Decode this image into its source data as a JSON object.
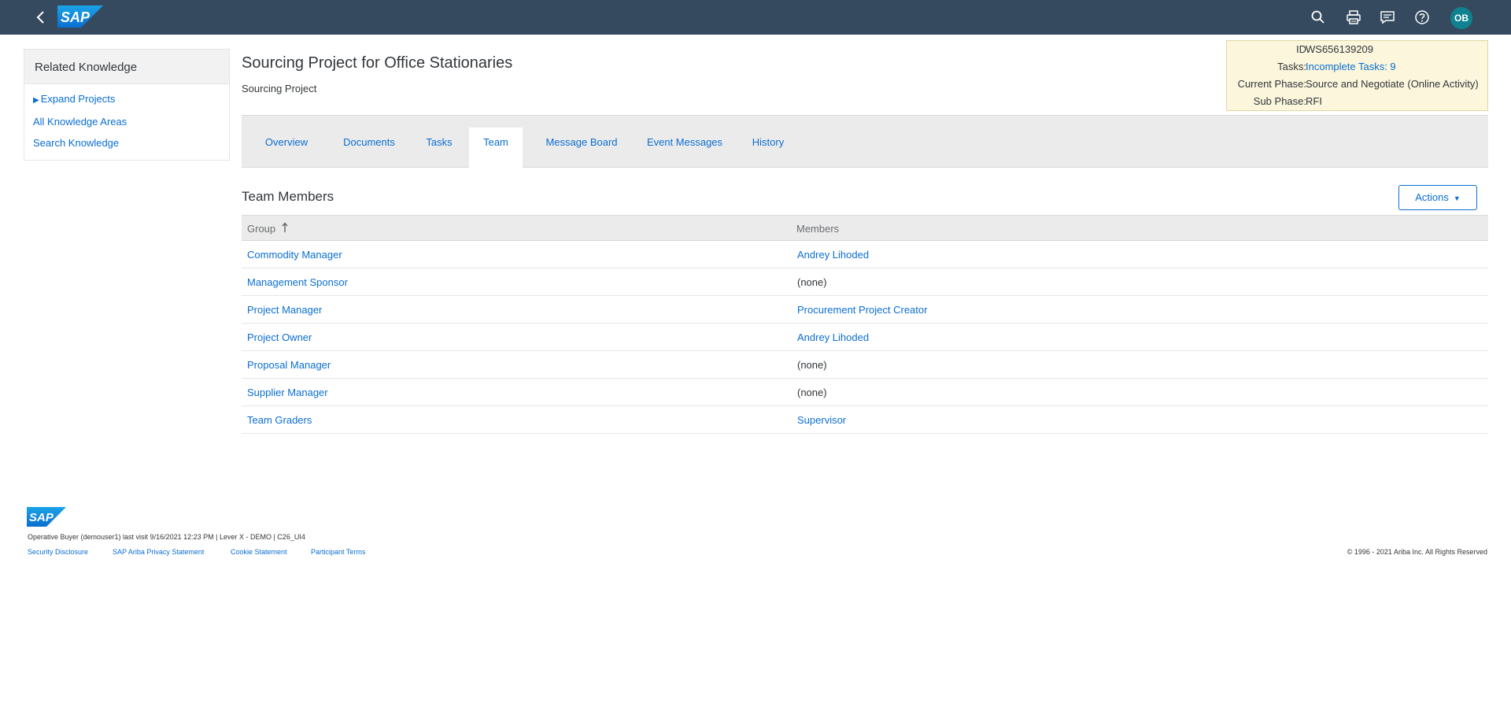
{
  "shell": {
    "logo_text": "SAP",
    "avatar_initials": "OB",
    "icons": [
      "back-icon",
      "search-icon",
      "print-icon",
      "feedback-icon",
      "help-icon"
    ],
    "bar_color": "#354a5f",
    "avatar_color": "#0f828f"
  },
  "related_knowledge": {
    "title": "Related Knowledge",
    "expand_label": "Expand Projects",
    "all_areas_label": "All Knowledge Areas",
    "search_label": "Search Knowledge"
  },
  "page": {
    "title": "Sourcing Project for Office Stationaries",
    "subtitle": "Sourcing Project"
  },
  "info": {
    "id_label": "ID",
    "id_value": "WS656139209",
    "tasks_label": "Tasks:",
    "tasks_value": "Incomplete Tasks: 9",
    "phase_label": "Current Phase:",
    "phase_value": "Source and Negotiate (Online Activity)",
    "subphase_label": "Sub Phase:",
    "subphase_value": "RFI"
  },
  "tabs": [
    {
      "label": "Overview",
      "active": false
    },
    {
      "label": "Documents",
      "active": false
    },
    {
      "label": "Tasks",
      "active": false
    },
    {
      "label": "Team",
      "active": true
    },
    {
      "label": "Message Board",
      "active": false
    },
    {
      "label": "Event Messages",
      "active": false
    },
    {
      "label": "History",
      "active": false
    }
  ],
  "team": {
    "title": "Team Members",
    "actions_label": "Actions",
    "columns": [
      "Group",
      "Members"
    ],
    "rows": [
      {
        "group": "Commodity Manager",
        "members": "Andrey Lihoded",
        "members_link": true
      },
      {
        "group": "Management Sponsor",
        "members": "(none)",
        "members_link": false
      },
      {
        "group": "Project Manager",
        "members": "Procurement Project Creator",
        "members_link": true
      },
      {
        "group": "Project Owner",
        "members": "Andrey Lihoded",
        "members_link": true
      },
      {
        "group": "Proposal Manager",
        "members": "(none)",
        "members_link": false
      },
      {
        "group": "Supplier Manager",
        "members": "(none)",
        "members_link": false
      },
      {
        "group": "Team Graders",
        "members": "Supervisor",
        "members_link": true
      }
    ]
  },
  "footer": {
    "logo_text": "SAP",
    "meta": "Operative Buyer (demouser1) last visit 9/16/2021 12:23 PM | Lever X - DEMO | C26_UI4",
    "links": [
      "Security Disclosure",
      "SAP Ariba Privacy Statement",
      "Cookie Statement",
      "Participant Terms"
    ],
    "copyright": "© 1996 - 2021 Ariba Inc. All Rights Reserved"
  }
}
